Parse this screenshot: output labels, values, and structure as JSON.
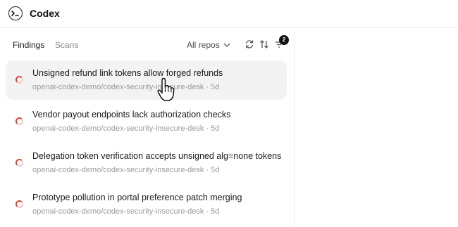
{
  "app": {
    "title": "Codex"
  },
  "tabs": [
    {
      "label": "Findings",
      "active": true
    },
    {
      "label": "Scans",
      "active": false
    }
  ],
  "filter": {
    "label": "All repos"
  },
  "filter_badge": "2",
  "findings": [
    {
      "title": "Unsigned refund link tokens allow forged refunds",
      "repo": "openai-codex-demo/codex-security-insecure-desk",
      "age": "5d"
    },
    {
      "title": "Vendor payout endpoints lack authorization checks",
      "repo": "openai-codex-demo/codex-security-insecure-desk",
      "age": "5d"
    },
    {
      "title": "Delegation token verification accepts unsigned alg=none tokens",
      "repo": "openai-codex-demo/codex-security-insecure-desk",
      "age": "5d"
    },
    {
      "title": "Prototype pollution in portal preference patch merging",
      "repo": "openai-codex-demo/codex-security-insecure-desk",
      "age": "5d"
    }
  ],
  "meta_separator": "·",
  "colors": {
    "status_red": "#d7473b",
    "hover_bg": "#f3f3f3",
    "badge_bg": "#111111"
  }
}
